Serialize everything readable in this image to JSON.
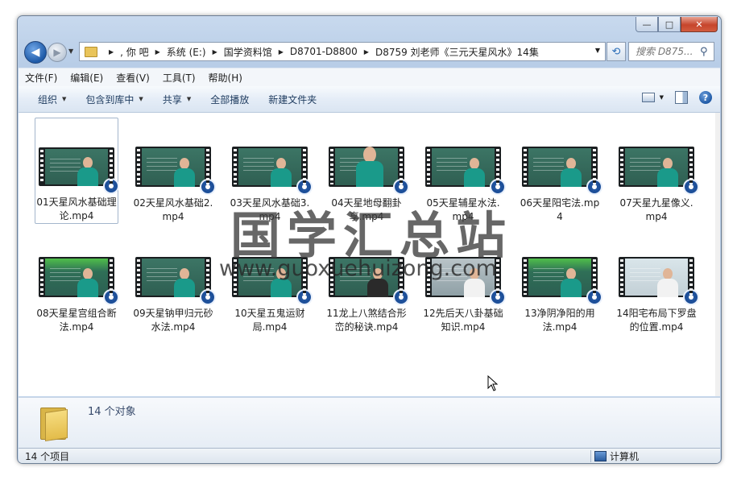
{
  "window": {
    "controls": {
      "minimize": "—",
      "maximize": "□",
      "close": "✕"
    }
  },
  "address": {
    "back_glyph": "◀",
    "forward_glyph": "▶",
    "crumbs": [
      ", 你  吧",
      "系统 (E:)",
      "国学资料馆",
      "D8701-D8800",
      "D8759 刘老师《三元天星风水》14集"
    ],
    "refresh_glyph": "⟲",
    "search_placeholder": "搜索 D875..."
  },
  "menu": [
    "文件(F)",
    "编辑(E)",
    "查看(V)",
    "工具(T)",
    "帮助(H)"
  ],
  "toolbar": {
    "organize": "组织",
    "include_library": "包含到库中",
    "share": "共享",
    "play_all": "全部播放",
    "new_folder": "新建文件夹",
    "help_glyph": "?"
  },
  "files": [
    {
      "name": "01天星风水基础理论.mp4",
      "scene": "teacher-paper"
    },
    {
      "name": "02天星风水基础2.mp4",
      "scene": "teacher"
    },
    {
      "name": "03天星风水基础3.mp4",
      "scene": "teacher"
    },
    {
      "name": "04天星地母翻卦享.mp4",
      "scene": "teacher-close"
    },
    {
      "name": "05天星辅星水法.mp4",
      "scene": "teacher"
    },
    {
      "name": "06天星阳宅法.mp4",
      "scene": "teacher"
    },
    {
      "name": "07天星九星像义.mp4",
      "scene": "teacher"
    },
    {
      "name": "08天星星宫组合断法.mp4",
      "scene": "teacher-bright"
    },
    {
      "name": "09天星钠甲归元砂水法.mp4",
      "scene": "teacher"
    },
    {
      "name": "10天星五鬼运财局.mp4",
      "scene": "teacher"
    },
    {
      "name": "11龙上八煞结合形峦的秘诀.mp4",
      "scene": "teacher-dark"
    },
    {
      "name": "12先后天八卦基础知识.mp4",
      "scene": "teacher-white"
    },
    {
      "name": "13净阴净阳的用法.mp4",
      "scene": "teacher-bright"
    },
    {
      "name": "14阳宅布局下罗盘的位置.mp4",
      "scene": "teacher-light"
    }
  ],
  "details": {
    "count_text": "14 个对象"
  },
  "status": {
    "left": "14 个项目",
    "right": "计算机"
  },
  "watermark": {
    "title": "国学汇总站",
    "url": "www.guoxuehuizong.com"
  },
  "colors": {
    "accent": "#1d4f99",
    "window_frame": "#b8cde7",
    "close": "#c6452c"
  }
}
